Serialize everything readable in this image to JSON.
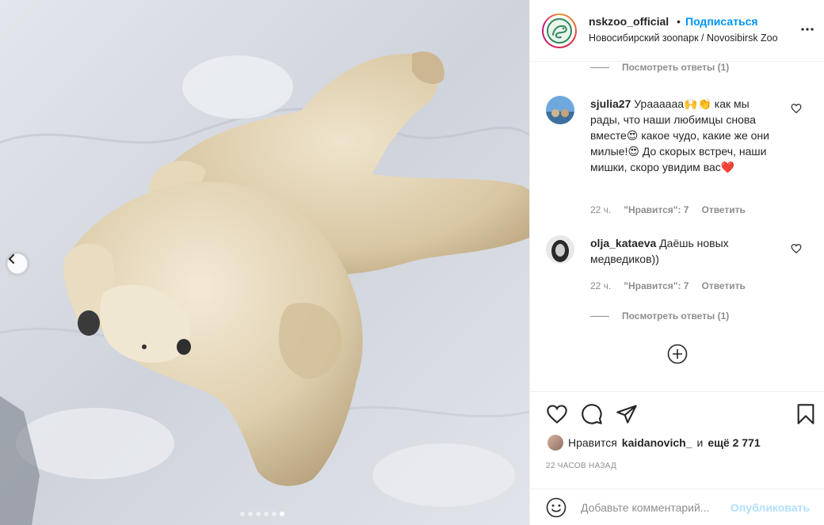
{
  "post": {
    "username": "nskzoo_official",
    "separator": "•",
    "follow_label": "Подписаться",
    "location": "Новосибирский зоопарк / Novosibirsk Zoo",
    "more_icon": "more-horizontal-icon"
  },
  "carousel": {
    "slide_count": 6,
    "active_index": 5
  },
  "comments": {
    "top_view_replies": "Посмотреть ответы (1)",
    "items": [
      {
        "username": "sjulia27",
        "text": "Ураааааа🙌👏 как мы рады, что наши любимцы снова вместе😍 какое чудо, какие же они милые!😍 До скорых встреч, наши мишки, скоро увидим вас❤️",
        "time": "22 ч.",
        "likes": "\"Нравится\": 7",
        "reply": "Ответить"
      },
      {
        "username": "olja_kataeva",
        "text": "Даёшь новых медведиков))",
        "time": "22 ч.",
        "likes": "\"Нравится\": 7",
        "reply": "Ответить",
        "view_replies": "Посмотреть ответы (1)"
      }
    ]
  },
  "actions": {
    "liked_by_prefix": "Нравится",
    "liked_by_user": "kaidanovich_",
    "liked_by_middle": "и",
    "liked_by_count": "ещё 2 771",
    "timestamp": "22 ЧАСОВ НАЗАД"
  },
  "add_comment": {
    "placeholder": "Добавьте комментарий...",
    "publish_label": "Опубликовать"
  },
  "colors": {
    "accent": "#0095f6",
    "publish_disabled": "#b2dffc",
    "muted": "#8e8e8e"
  }
}
